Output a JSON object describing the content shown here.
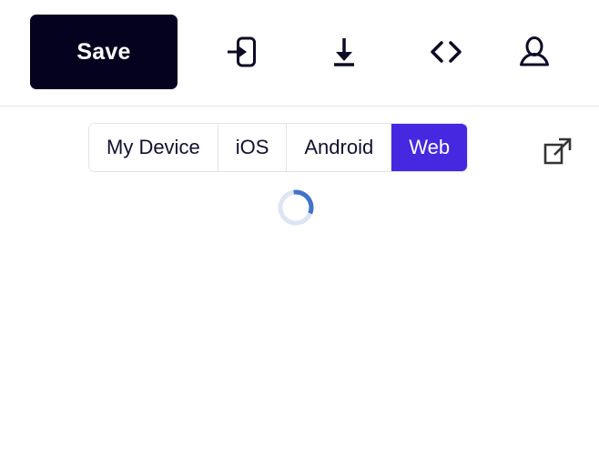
{
  "toolbar": {
    "save_label": "Save",
    "icons": [
      {
        "name": "preview-on-device-icon",
        "title": "Preview on device"
      },
      {
        "name": "download-icon",
        "title": "Download"
      },
      {
        "name": "code-icon",
        "title": "View code"
      },
      {
        "name": "account-icon",
        "title": "Account"
      }
    ]
  },
  "platform_bar": {
    "segments": [
      {
        "label": "My Device",
        "active": false
      },
      {
        "label": "iOS",
        "active": false
      },
      {
        "label": "Android",
        "active": false
      },
      {
        "label": "Web",
        "active": true
      }
    ],
    "open_external_label": "Open in new window"
  },
  "preview": {
    "status": "loading",
    "spinner_label": "Loading preview"
  },
  "colors": {
    "save_button_bg": "#05021f",
    "active_segment_bg": "#4528e0",
    "text": "#12102e",
    "border": "#e4e4e7",
    "divider": "#e2e2e4",
    "spinner_track": "#dde4f4",
    "spinner_arc": "#4174c9",
    "external_icon": "#343434"
  }
}
